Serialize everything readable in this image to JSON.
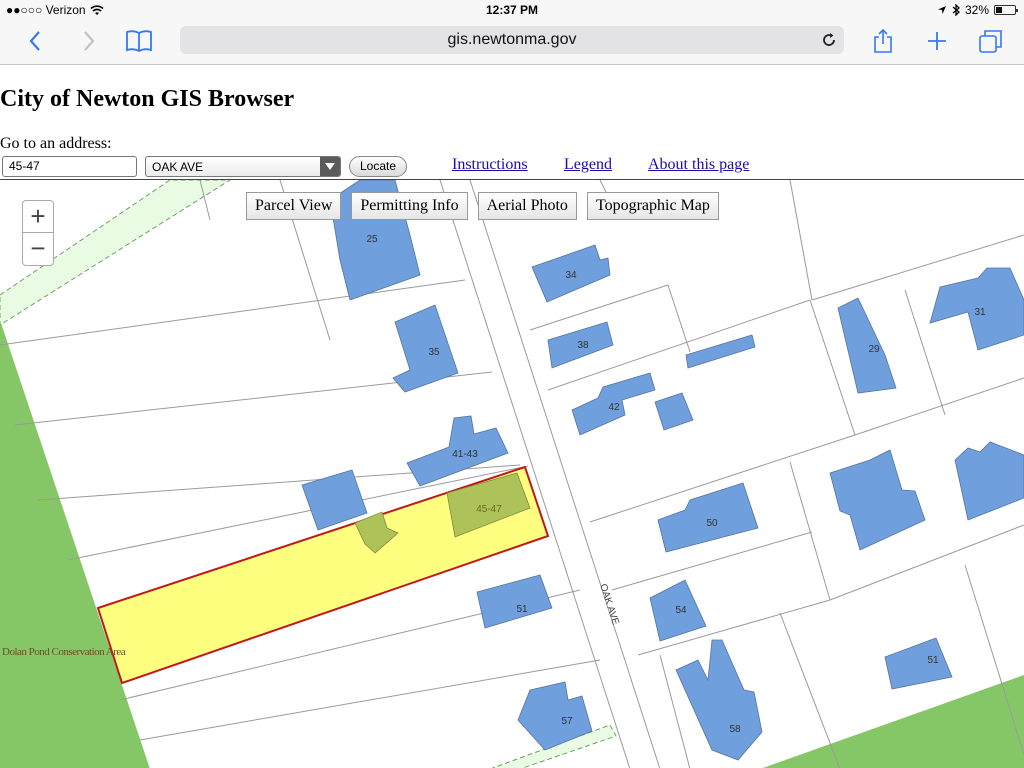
{
  "status": {
    "carrier": "●●○○○ Verizon",
    "time": "12:37 PM",
    "battery": "32%",
    "battery_level": 0.32
  },
  "browser": {
    "url": "gis.newtonma.gov"
  },
  "page": {
    "title": "City of Newton GIS Browser",
    "goto_label": "Go to an address:",
    "address_value": "45-47",
    "street_value": "OAK AVE",
    "locate_label": "Locate",
    "links": [
      "Instructions",
      "Legend",
      "About this page"
    ]
  },
  "map": {
    "tabs": [
      "Parcel View",
      "Permitting Info",
      "Aerial Photo",
      "Topographic Map"
    ],
    "zoom_in": "+",
    "zoom_out": "−",
    "street_label": "OAK AVE",
    "area_label": "Dolan Pond Conservation Area",
    "building_numbers": [
      "25",
      "34",
      "31",
      "35",
      "38",
      "29",
      "42",
      "41-43",
      "45-47",
      "50",
      "51",
      "54",
      "51",
      "57",
      "58"
    ],
    "colors": {
      "building": "#6f9fdc",
      "selected_parcel": "#ffff7f",
      "selected_outline": "#c0191b",
      "conservation": "#85c766",
      "easement": "#eafbe4"
    }
  }
}
